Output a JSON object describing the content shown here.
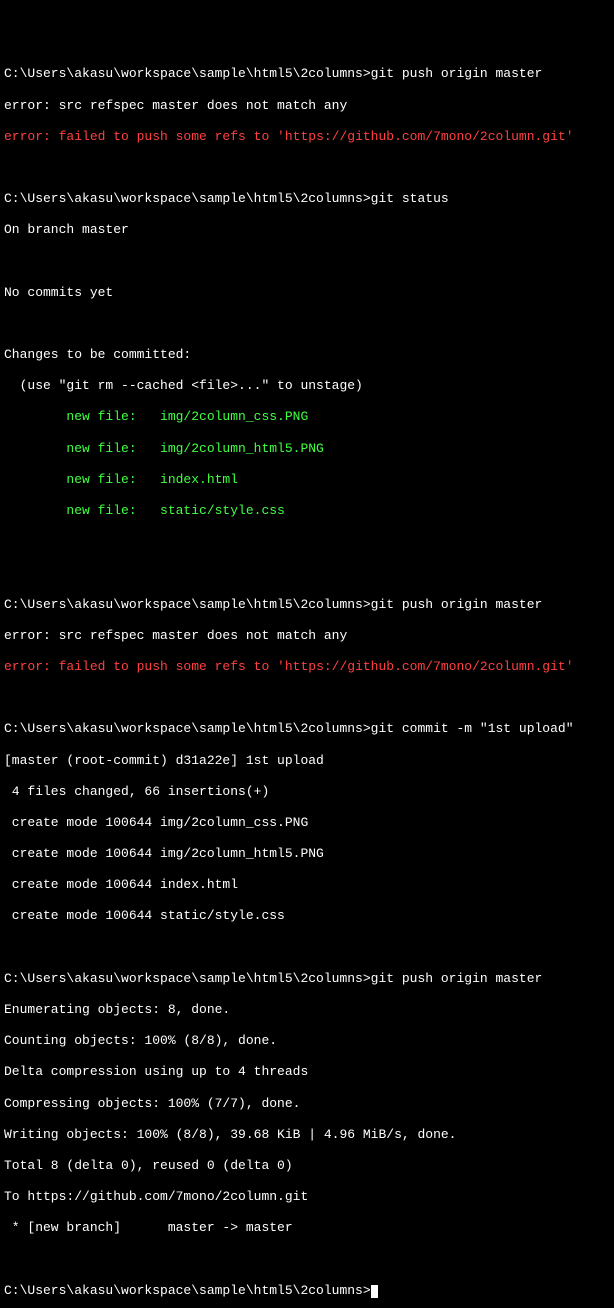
{
  "prompt_path": "C:\\Users\\akasu\\workspace\\sample\\html5\\2columns>",
  "cmd_push": "git push origin master",
  "err_refspec": "error: src refspec master does not match any",
  "err_failed_prefix": "error: failed to push some refs to '",
  "err_failed_url": "https://github.com/7mono/2column.git",
  "err_failed_suffix": "'",
  "cmd_status": "git status",
  "status_branch": "On branch master",
  "status_nocommits": "No commits yet",
  "status_changes": "Changes to be committed:",
  "status_hint": "  (use \"git rm --cached <file>...\" to unstage)",
  "status_files": [
    "        new file:   img/2column_css.PNG",
    "        new file:   img/2column_html5.PNG",
    "        new file:   index.html",
    "        new file:   static/style.css"
  ],
  "cmd_commit": "git commit -m \"1st upload\"",
  "commit_out": [
    "[master (root-commit) d31a22e] 1st upload",
    " 4 files changed, 66 insertions(+)",
    " create mode 100644 img/2column_css.PNG",
    " create mode 100644 img/2column_html5.PNG",
    " create mode 100644 index.html",
    " create mode 100644 static/style.css"
  ],
  "push_out": [
    "Enumerating objects: 8, done.",
    "Counting objects: 100% (8/8), done.",
    "Delta compression using up to 4 threads",
    "Compressing objects: 100% (7/7), done.",
    "Writing objects: 100% (8/8), 39.68 KiB | 4.96 MiB/s, done.",
    "Total 8 (delta 0), reused 0 (delta 0)",
    "To https://github.com/7mono/2column.git",
    " * [new branch]      master -> master"
  ]
}
